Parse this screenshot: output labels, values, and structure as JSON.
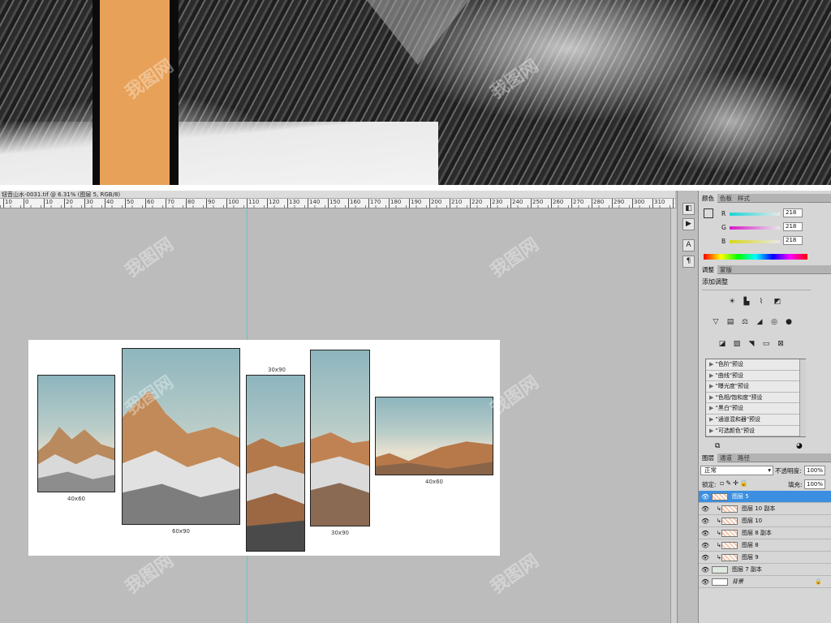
{
  "document": {
    "title": "钮音山水-0031.tif @ 6.31% (图层 5, RGB/8)"
  },
  "ruler": {
    "ticks": [
      "10",
      "0",
      "10",
      "20",
      "30",
      "40",
      "50",
      "60",
      "70",
      "80",
      "90",
      "100",
      "110",
      "120",
      "130",
      "140",
      "150",
      "160",
      "170",
      "180",
      "190",
      "200",
      "210",
      "220",
      "230",
      "240",
      "250",
      "260",
      "270",
      "280",
      "290",
      "300",
      "310",
      "320"
    ]
  },
  "canvas": {
    "panels": [
      {
        "size_label": "40x60"
      },
      {
        "size_label": "60x90"
      },
      {
        "size_label": "30x90"
      },
      {
        "size_label": "30x90"
      },
      {
        "size_label": "40x60"
      }
    ]
  },
  "color_panel": {
    "tabs": [
      "颜色",
      "色板",
      "样式"
    ],
    "channels": [
      {
        "label": "R",
        "value": "218",
        "color": "#19d4d6"
      },
      {
        "label": "G",
        "value": "218",
        "color": "#d619c8"
      },
      {
        "label": "B",
        "value": "218",
        "color": "#d8d619"
      }
    ]
  },
  "adjust_panel": {
    "tabs": [
      "调整",
      "蒙版"
    ],
    "title": "添加调整",
    "presets": [
      "\"色阶\"预设",
      "\"曲线\"预设",
      "\"曝光度\"预设",
      "\"色相/饱和度\"预设",
      "\"黑白\"预设",
      "\"通道混和器\"预设",
      "\"可选颜色\"预设"
    ]
  },
  "layers_panel": {
    "tabs": [
      "图层",
      "通道",
      "路径"
    ],
    "blend_mode": "正常",
    "opacity_label": "不透明度:",
    "opacity": "100%",
    "lock_label": "锁定:",
    "fill_label": "填充:",
    "fill": "100%",
    "layers": [
      {
        "name": "图层 5",
        "selected": true,
        "linked": false
      },
      {
        "name": "图层 10 副本",
        "selected": false,
        "linked": true
      },
      {
        "name": "图层 10",
        "selected": false,
        "linked": true
      },
      {
        "name": "图层 8 副本",
        "selected": false,
        "linked": true
      },
      {
        "name": "图层 8",
        "selected": false,
        "linked": true
      },
      {
        "name": "图层 9",
        "selected": false,
        "linked": true
      },
      {
        "name": "图层 7 副本",
        "selected": false,
        "linked": false
      },
      {
        "name": "背景",
        "selected": false,
        "linked": false
      }
    ]
  },
  "watermark": "我图网",
  "colors": {
    "accent_orange": "#e8a158",
    "selection_blue": "#3c8fe0",
    "guide": "#4fd0d6"
  }
}
